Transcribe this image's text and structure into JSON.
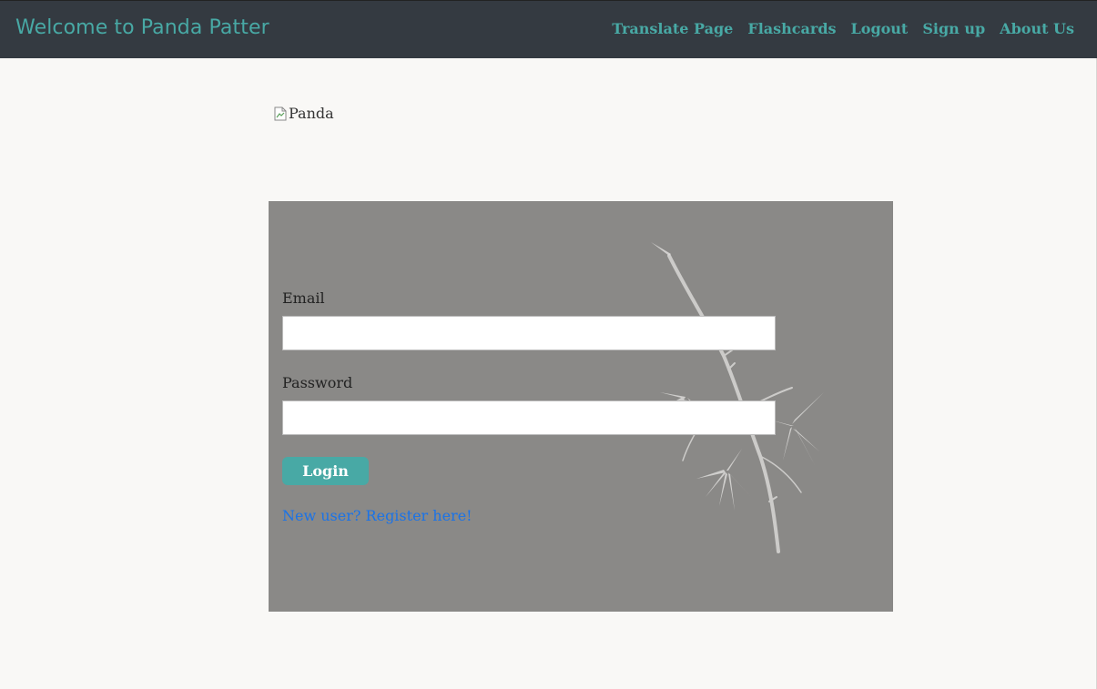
{
  "navbar": {
    "brand": "Welcome to Panda Patter",
    "links": [
      "Translate Page",
      "Flashcards",
      "Logout",
      "Sign up",
      "About Us"
    ],
    "accent_color": "#48a9a5",
    "background_color": "#343a41"
  },
  "hero": {
    "image_alt": "Panda",
    "image_icon": "broken-image-icon"
  },
  "login_form": {
    "email_label": "Email",
    "email_value": "",
    "password_label": "Password",
    "password_value": "",
    "login_button": "Login",
    "register_link": "New user? Register here!",
    "card_color": "#8a8987",
    "decoration": "bamboo-illustration"
  }
}
